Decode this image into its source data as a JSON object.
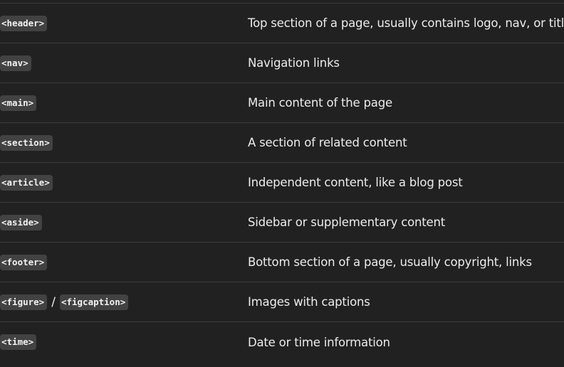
{
  "rows": [
    {
      "tag": "<header>",
      "description": "Top section of a page, usually contains logo, nav, or title"
    },
    {
      "tag": "<nav>",
      "description": "Navigation links"
    },
    {
      "tag": "<main>",
      "description": "Main content of the page"
    },
    {
      "tag": "<section>",
      "description": "A section of related content"
    },
    {
      "tag": "<article>",
      "description": "Independent content, like a blog post"
    },
    {
      "tag": "<aside>",
      "description": "Sidebar or supplementary content"
    },
    {
      "tag": "<footer>",
      "description": "Bottom section of a page, usually copyright, links"
    },
    {
      "tag": "<figure>",
      "separator": "/",
      "tag2": "<figcaption>",
      "description": "Images with captions"
    },
    {
      "tag": "<time>",
      "description": "Date or time information"
    }
  ]
}
